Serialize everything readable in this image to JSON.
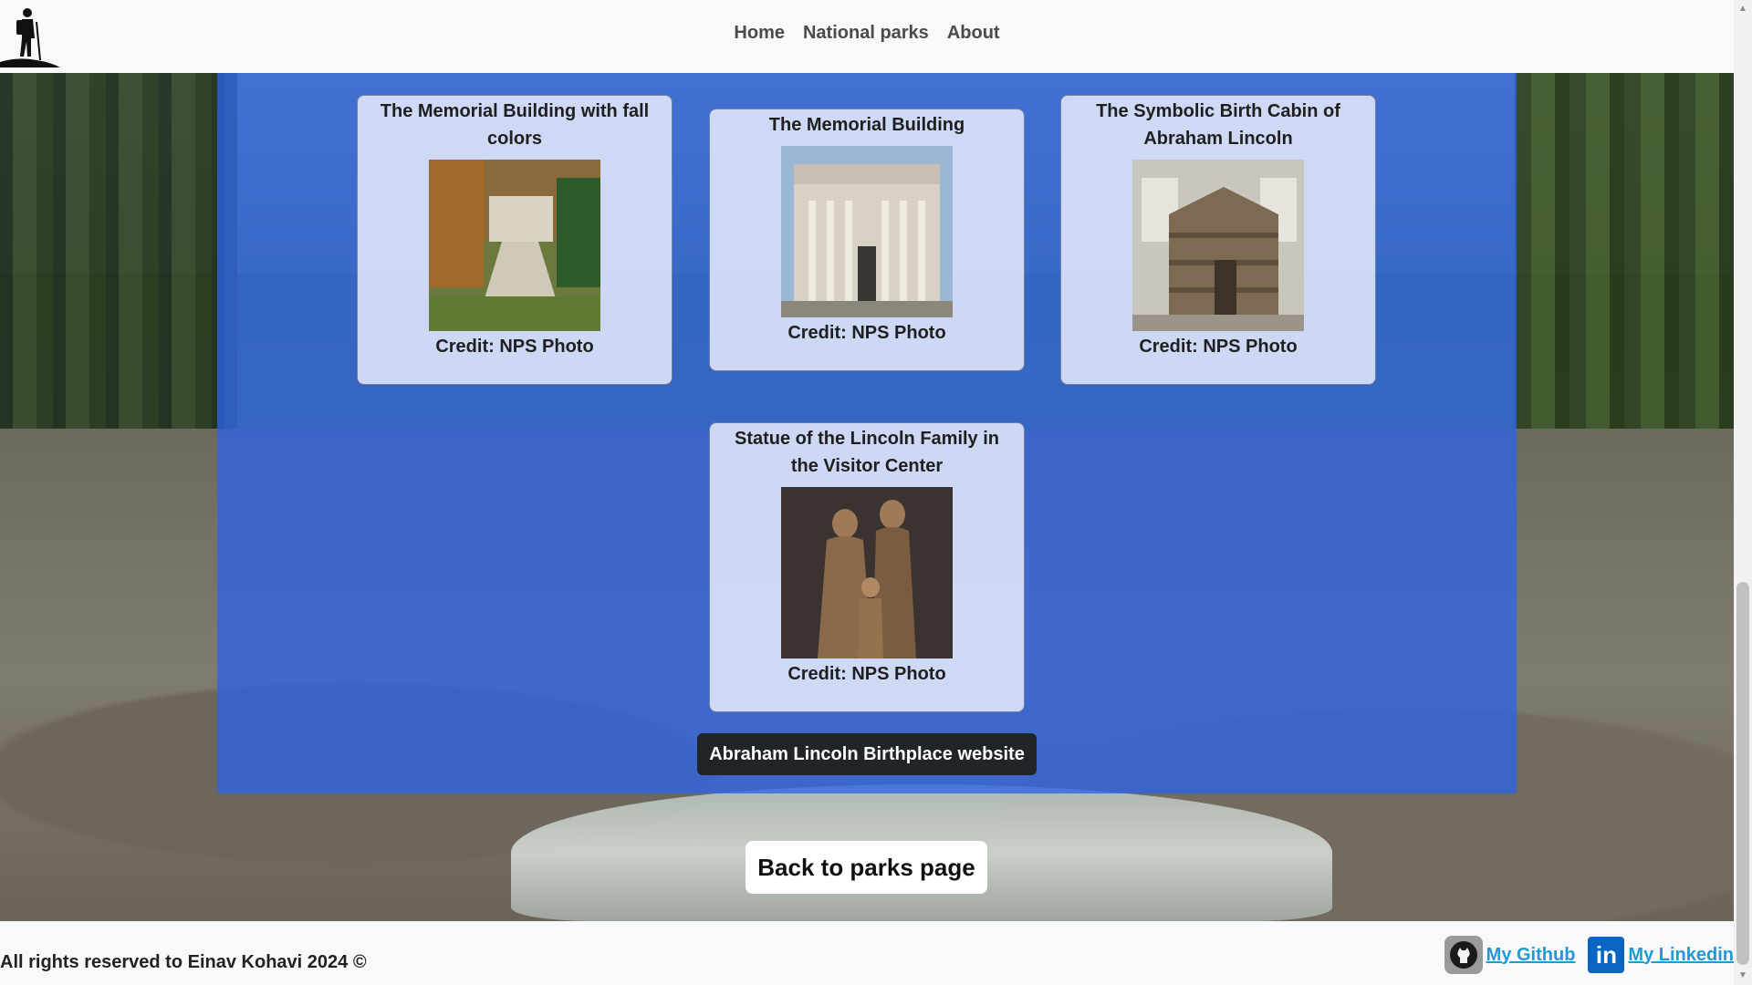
{
  "nav": {
    "links": [
      "Home",
      "National parks",
      "About"
    ]
  },
  "gallery": {
    "cards": [
      {
        "title": "The Memorial Building with fall colors",
        "credit": "Credit: NPS Photo"
      },
      {
        "title": "The Memorial Building",
        "credit": "Credit: NPS Photo"
      },
      {
        "title": "The Symbolic Birth Cabin of Abraham Lincoln",
        "credit": "Credit: NPS Photo"
      },
      {
        "title": "Statue of the Lincoln Family in the Visitor Center",
        "credit": "Credit: NPS Photo"
      }
    ]
  },
  "website_button": "Abraham Lincoln Birthplace website",
  "back_button": "Back to parks page",
  "footer": {
    "copyright": "All rights reserved to Einav Kohavi 2024 ©",
    "github_label": "My Github",
    "linkedin_label": "My Linkedin",
    "linkedin_icon_text": "in"
  },
  "colors": {
    "overlay": "#2d64e6",
    "button_dark": "#212529",
    "link": "#1e9ad6"
  }
}
